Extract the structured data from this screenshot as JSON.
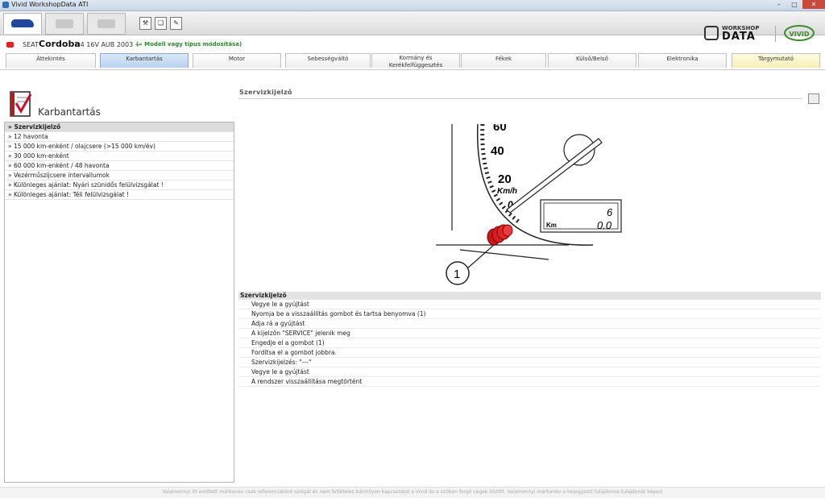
{
  "window": {
    "title": "Vivid WorkshopData ATI"
  },
  "toolbar": {
    "tool_icons": [
      "car-icon",
      "folder-icon",
      "folder-icon",
      "print-tools-icon"
    ]
  },
  "logos": {
    "workshop_top": "WORKSHOP",
    "workshop_main": "DATA",
    "vivid": "VIVID"
  },
  "vehicle": {
    "make": "SEAT",
    "model": "Cordoba",
    "spec": "1.4 16V AUB 2003 --",
    "change_link": "(« Modell vagy típus módosítása)"
  },
  "tabs": [
    {
      "label": "Áttekintés"
    },
    {
      "label": "Karbantartás"
    },
    {
      "label": "Motor"
    },
    {
      "label": "Sebességváltó"
    },
    {
      "label": "Kormány és Kerékfelfüggesztés"
    },
    {
      "label": "Fékek"
    },
    {
      "label": "Külső/Belső"
    },
    {
      "label": "Elektronika"
    },
    {
      "label": "Tárgymutató"
    }
  ],
  "sidebar": {
    "title": "Karbantartás",
    "items": [
      {
        "label": "» Szervizkijelző"
      },
      {
        "label": "» 12 havonta"
      },
      {
        "label": "» 15 000 km-enként / olajcsere (>15 000 km/év)"
      },
      {
        "label": "» 30 000 km-enként"
      },
      {
        "label": "» 60 000 km-enként / 48 havonta"
      },
      {
        "label": "» Vezérműszíjcsere intervallumok"
      },
      {
        "label": "» Különleges ajánlat: Nyári szünidős felülvizsgálat !"
      },
      {
        "label": "» Különleges ajánlat: Téli felülvizsgálat !"
      }
    ]
  },
  "content": {
    "title": "Szervizkijelző",
    "diagram": {
      "labels": [
        "60",
        "40",
        "20",
        "Km/h",
        "0",
        "6",
        "0.0",
        "Km",
        "1"
      ]
    },
    "steps_title": "Szervizkijelző",
    "steps": [
      "Vegye le a gyújtást",
      "Nyomja be a visszaállítás gombot és tartsa benyomva (1)",
      "Adja rá a gyújtást",
      "A kijelzőn \"SERVICE\" jelenik meg",
      "Engedje el a gombot (1)",
      "Fordítsa el a gombot jobbra.",
      "Szervizkijelzés: \"---\"",
      "Vegye le a gyújtást",
      "A rendszer visszaállítása megtörtént"
    ]
  },
  "footer": {
    "text": "Valamennyi itt említett márkanév csak referenciaként szolgál és nem feltételez bármilyen kapcsolatot a Vivid és a szóban forgó cégek között. Valamennyi márkanév a bejegyzett tulajdonos tulajdonát képezi"
  }
}
